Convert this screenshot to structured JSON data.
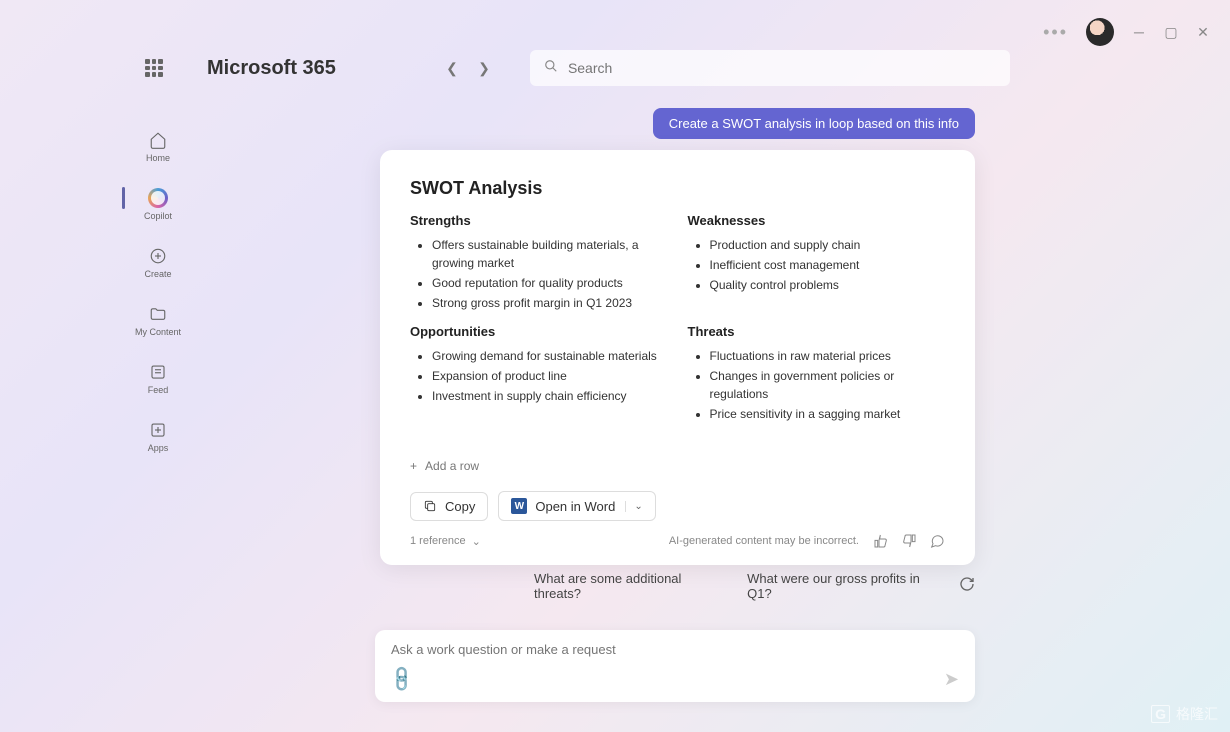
{
  "app": {
    "title": "Microsoft 365"
  },
  "search": {
    "placeholder": "Search"
  },
  "sidebar": {
    "items": [
      {
        "label": "Home"
      },
      {
        "label": "Copilot"
      },
      {
        "label": "Create"
      },
      {
        "label": "My Content"
      },
      {
        "label": "Feed"
      },
      {
        "label": "Apps"
      }
    ]
  },
  "user_message": "Create a SWOT analysis in loop based on this info",
  "swot": {
    "title": "SWOT Analysis",
    "strengths": {
      "heading": "Strengths",
      "items": [
        "Offers sustainable building materials, a growing market",
        "Good reputation for quality products",
        "Strong gross profit margin in Q1 2023"
      ]
    },
    "weaknesses": {
      "heading": "Weaknesses",
      "items": [
        "Production and supply chain",
        "Inefficient cost management",
        "Quality control problems"
      ]
    },
    "opportunities": {
      "heading": "Opportunities",
      "items": [
        "Growing demand for sustainable materials",
        "Expansion of product line",
        "Investment in supply chain efficiency"
      ]
    },
    "threats": {
      "heading": "Threats",
      "items": [
        "Fluctuations in raw material prices",
        "Changes in government policies or regulations",
        "Price sensitivity in a sagging market"
      ]
    },
    "add_row": "Add a row"
  },
  "toolbar": {
    "copy": "Copy",
    "open_word": "Open in Word"
  },
  "footer": {
    "references": "1 reference",
    "disclaimer": "AI-generated content may be incorrect."
  },
  "suggestions": [
    "What are some additional threats?",
    "What were our gross profits in Q1?"
  ],
  "compose": {
    "placeholder": "Ask a work question or make a request"
  },
  "watermark": "格隆汇"
}
